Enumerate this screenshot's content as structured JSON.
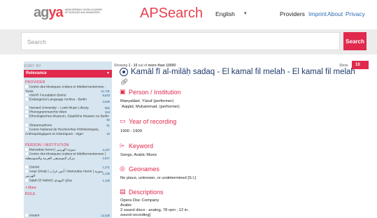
{
  "header": {
    "logo_mark": "ag",
    "logo_mark_o": "ya",
    "logo_line1": "ARAB GERMAN YOUNG ACADEMY",
    "logo_line2": "OF SCIENCES AND HUMANITIES",
    "app_title": "APSearch",
    "language": "English",
    "nav": {
      "providers": "Providers",
      "imprint": "Imprint",
      "about": "About",
      "privacy": "Privacy"
    }
  },
  "search": {
    "placeholder": "Search",
    "button": "Search"
  },
  "sidebar": {
    "sort_by": "SORT BY",
    "sort_value": "Relevance",
    "provider_title": "PROVIDER",
    "provider_items": [
      {
        "label": "Centre des Musiques Arabes et Méditerranéennes - Tunis",
        "count": "11,731"
      },
      {
        "label": "AMAR Foundation Beirut",
        "count": "8,833"
      },
      {
        "label": "Endangered Language Archive - Berlin",
        "count": "4,526"
      },
      {
        "label": "Harvard University – Loeb Music Library",
        "count": "562"
      },
      {
        "label": "Phonogrammarchiv Wien",
        "count": "318"
      },
      {
        "label": "Ethnologisches Museum, Staatliche Museen zu Berlin",
        "count": "92"
      },
      {
        "label": "Sharamophone",
        "count": "51"
      },
      {
        "label": "Centre National de Recherches Préhistoriques, Anthropologiques et Historiques - Alger",
        "count": "10"
      }
    ],
    "person_title": "PERSON / INSTITUTION",
    "person_items": [
      {
        "label": "Manoubia Hermi | منوبية الهرمي",
        "count": "3,107"
      },
      {
        "label": "Centre des Musiques Arabes et Méditerranéennes | مركز الموسيقى العربية والمتوسطية",
        "count": "2,917"
      },
      {
        "label": "CMAM",
        "count": "1,271"
      },
      {
        "label": "Anas Ghrab | أنس غراب / Manoubia Hermi | منوبية الهرمي",
        "count": "1,135"
      },
      {
        "label": "Salah El Mahdi | صالح المهدي",
        "count": "1,106"
      }
    ],
    "more": "+ More",
    "role_title": "ROLE",
    "role_items": [
      {
        "label": "creator",
        "count": "13,426"
      }
    ]
  },
  "results": {
    "showing_prefix": "Showing",
    "showing_range": "1 - 10",
    "showing_mid": "out of",
    "showing_total": "more than 10000",
    "show_label": "Show",
    "show_value": "10"
  },
  "record": {
    "title": "Kamāl fī al-milāḥ sadaq - El kamal fil melah - El kamal fil melah",
    "person_heading": "Person / Institution",
    "person_lines": [
      "Manyalāwī, Yūsuf (performer)",
      "ʿAqqād, Muḥammad. (performer)"
    ],
    "year_heading": "Year of recording",
    "year_value": "1900 - 1909",
    "keyword_heading": "Keyword",
    "keyword_value": "Songs, Arabic  Music",
    "geo_heading": "Geonames",
    "geo_value": "No place, unknown, or undetermined [S.l.]",
    "desc_heading": "Descriptions",
    "desc_lines": [
      "Opera Disc Company",
      "Arabic",
      "2 sound discs : analog, 78 rpm ; 12 in.",
      "sound recording]"
    ]
  },
  "colors": {
    "accent": "#e0294d",
    "title_blue": "#1f3a6b",
    "link_blue": "#2b6cb0",
    "sidebar_bg": "#d6e5ef"
  },
  "icons": [
    "radio-target-icon",
    "link-icon",
    "person-card-icon",
    "calendar-icon",
    "tag-icon",
    "pin-icon",
    "document-icon"
  ]
}
